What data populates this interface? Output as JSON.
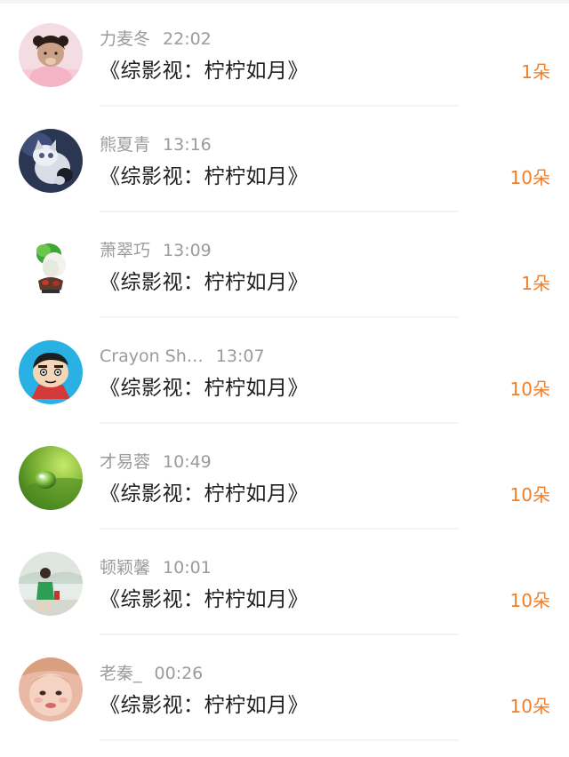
{
  "colors": {
    "accent": "#f07f2a",
    "name_text": "#9b9b9b",
    "title_text": "#1f1f1f"
  },
  "rows": [
    {
      "name": "力麦冬",
      "time": "22:02",
      "title": "《综影视：柠柠如月》",
      "count": "1朵",
      "avatar": "girl-avatar-icon"
    },
    {
      "name": "熊夏青",
      "time": "13:16",
      "title": "《综影视：柠柠如月》",
      "count": "10朵",
      "avatar": "cat-avatar-icon"
    },
    {
      "name": "萧翠巧",
      "time": "13:09",
      "title": "《综影视：柠柠如月》",
      "count": "1朵",
      "avatar": "cabbage-avatar-icon"
    },
    {
      "name": "Crayon Sh…",
      "time": "13:07",
      "title": "《综影视：柠柠如月》",
      "count": "10朵",
      "avatar": "cartoon-avatar-icon"
    },
    {
      "name": "才易蓉",
      "time": "10:49",
      "title": "《综影视：柠柠如月》",
      "count": "10朵",
      "avatar": "waterdrop-avatar-icon"
    },
    {
      "name": "顿颖馨",
      "time": "10:01",
      "title": "《综影视：柠柠如月》",
      "count": "10朵",
      "avatar": "person-avatar-icon"
    },
    {
      "name": "老秦_",
      "time": "00:26",
      "title": "《综影视：柠柠如月》",
      "count": "10朵",
      "avatar": "face-avatar-icon"
    }
  ]
}
